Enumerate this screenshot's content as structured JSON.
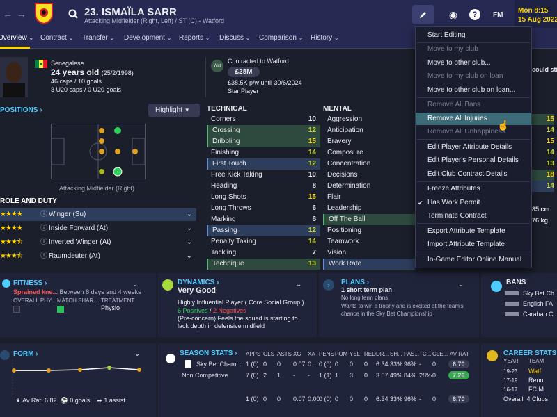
{
  "header": {
    "back_icon": "back-arrow-icon",
    "forward_icon": "forward-arrow-icon",
    "search_icon": "search-icon",
    "player_title": "23. ISMAÏLA SARR",
    "player_sub": "Attacking Midfielder (Right, Left) / ST (C) - Watford",
    "time": "Mon 8:15",
    "date": "15 Aug 2022",
    "fm_label": "FM"
  },
  "tabs": [
    "Overview",
    "Contract",
    "Transfer",
    "Development",
    "Reports",
    "Discuss",
    "Comparison",
    "History"
  ],
  "bio": {
    "nationality": "Senegalese",
    "age": "24 years old",
    "dob": "(25/2/1998)",
    "caps": "46 caps / 10 goals",
    "u20": "3 U20 caps / 0 U20 goals"
  },
  "contract": {
    "club_badge": "Wat",
    "title": "Contracted to Watford",
    "value": "£28M",
    "wage": "£38.5K p/w until 30/6/2024",
    "status": "Star Player",
    "cutoff": "could stil"
  },
  "positions": {
    "title": "POSITIONS",
    "highlight": "Highlight",
    "pos_label": "Attacking Midfielder (Right)"
  },
  "roles": {
    "title": "ROLE AND DUTY",
    "items": [
      {
        "name": "Winger (Su)",
        "stars": 4
      },
      {
        "name": "Inside Forward (At)",
        "stars": 4
      },
      {
        "name": "Inverted Winger (At)",
        "stars": 3.5
      },
      {
        "name": "Raumdeuter (At)",
        "stars": 3.5
      }
    ]
  },
  "technical": {
    "title": "TECHNICAL",
    "attrs": [
      [
        "Corners",
        "10",
        ""
      ],
      [
        "Crossing",
        "12",
        "green"
      ],
      [
        "Dribbling",
        "15",
        "green"
      ],
      [
        "Finishing",
        "14",
        ""
      ],
      [
        "First Touch",
        "12",
        "blue"
      ],
      [
        "Free Kick Taking",
        "10",
        ""
      ],
      [
        "Heading",
        "8",
        ""
      ],
      [
        "Long Shots",
        "15",
        ""
      ],
      [
        "Long Throws",
        "6",
        ""
      ],
      [
        "Marking",
        "6",
        ""
      ],
      [
        "Passing",
        "12",
        "blue"
      ],
      [
        "Penalty Taking",
        "14",
        ""
      ],
      [
        "Tackling",
        "7",
        ""
      ],
      [
        "Technique",
        "13",
        "green"
      ]
    ]
  },
  "mental": {
    "title": "MENTAL",
    "attrs": [
      [
        "Aggression",
        ""
      ],
      [
        "Anticipation",
        ""
      ],
      [
        "Bravery",
        ""
      ],
      [
        "Composure",
        ""
      ],
      [
        "Concentration",
        ""
      ],
      [
        "Decisions",
        ""
      ],
      [
        "Determination",
        ""
      ],
      [
        "Flair",
        ""
      ],
      [
        "Leadership",
        ""
      ],
      [
        "Off The Ball",
        "green"
      ],
      [
        "Positioning",
        ""
      ],
      [
        "Teamwork",
        ""
      ],
      [
        "Vision",
        ""
      ],
      [
        "Work Rate",
        "blue"
      ]
    ]
  },
  "right_col": {
    "values": [
      "15",
      "14",
      "15",
      "14",
      "13",
      "18",
      "14"
    ],
    "height": "85 cm",
    "weight": "76 kg"
  },
  "menu": {
    "items": [
      {
        "label": "Start Editing",
        "dis": false
      },
      {
        "label": "Move to my club",
        "dis": true
      },
      {
        "label": "Move to other club...",
        "dis": false
      },
      {
        "label": "Move to my club on loan",
        "dis": true
      },
      {
        "label": "Move to other club on loan...",
        "dis": false
      },
      {
        "label": "Remove All Bans",
        "dis": true
      },
      {
        "label": "Remove All Injuries",
        "dis": false,
        "hover": true
      },
      {
        "label": "Remove All Unhappiness",
        "dis": true
      },
      {
        "label": "Edit Player Attribute Details",
        "dis": false
      },
      {
        "label": "Edit Player's Personal Details",
        "dis": false
      },
      {
        "label": "Edit Club Contract Details",
        "dis": false
      },
      {
        "label": "Freeze Attributes",
        "dis": false
      },
      {
        "label": "Has Work Permit",
        "dis": false,
        "checked": true
      },
      {
        "label": "Terminate Contract",
        "dis": false
      },
      {
        "label": "Export Attribute Template",
        "dis": false
      },
      {
        "label": "Import Attribute Template",
        "dis": false
      },
      {
        "label": "In-Game Editor Online Manual",
        "dis": false
      }
    ]
  },
  "fitness": {
    "title": "FITNESS",
    "injury": "Sprained kne...",
    "duration": "Between 8 days and 4 weeks",
    "col1": "OVERALL PHY...",
    "col2": "MATCH SHAR...",
    "col3": "TREATMENT",
    "treatment": "Physio"
  },
  "dynamics": {
    "title": "DYNAMICS",
    "status": "Very Good",
    "influence": "Highly Influential Player",
    "group": "( Core Social Group )",
    "positives": "6 Positives",
    "sep": " / ",
    "negatives": "2 Negatives",
    "note": "(Pre-concern) Feels the squad is starting to lack depth in defensive midfield"
  },
  "plans": {
    "title": "PLANS",
    "main": "1 short term plan",
    "l1": "No long term plans",
    "l2": "Wants to win a trophy and is excited at the team's chance in the Sky Bet Championship"
  },
  "bans": {
    "title": "BANS",
    "rows": [
      "Sky Bet Ch",
      "English FA",
      "Carabao Cu"
    ]
  },
  "form": {
    "title": "FORM",
    "av": "Av Rat: 6.82",
    "goals": "0 goals",
    "assists": "1 assist"
  },
  "season": {
    "title": "SEASON STATS",
    "headers": [
      "APPS",
      "GLS",
      "ASTS",
      "XG",
      "XA",
      "PENS",
      "POM",
      "YEL",
      "RED",
      "DR...",
      "SH...",
      "PAS...",
      "TC...",
      "CLE...",
      "AV RAT"
    ],
    "rows": [
      {
        "name": "Sky Bet Cham...",
        "cells": [
          "1 (0)",
          "0",
          "0",
          "0.07",
          "0....",
          "0 (0)",
          "0",
          "0",
          "0",
          "6.34",
          "33%",
          "96%",
          "-",
          "0",
          "6.70"
        ]
      },
      {
        "name": "Non Competitive",
        "cells": [
          "7 (0)",
          "2",
          "1",
          "-",
          "-",
          "1 (1)",
          "1",
          "3",
          "0",
          "3.07",
          "49%",
          "84%",
          "28%",
          "0",
          "7.26"
        ]
      },
      {
        "name": "",
        "cells": [
          "1 (0)",
          "0",
          "0",
          "0.07",
          "0.00",
          "0 (0)",
          "0",
          "0",
          "0",
          "6.34",
          "33%",
          "96%",
          "-",
          "0",
          "6.70"
        ]
      }
    ]
  },
  "career": {
    "title": "CAREER STATS",
    "col1": "YEAR",
    "col2": "TEAM",
    "rows": [
      [
        "19-23",
        "Watf"
      ],
      [
        "17-19",
        "Renn"
      ],
      [
        "16-17",
        "FC M"
      ]
    ],
    "overall": "Overall",
    "clubs": "4 Clubs"
  },
  "colors": {
    "accent": "#4ecbff",
    "yellow": "#ffd400",
    "topbar": "#262a52",
    "menu_hover": "#3d6b78"
  }
}
